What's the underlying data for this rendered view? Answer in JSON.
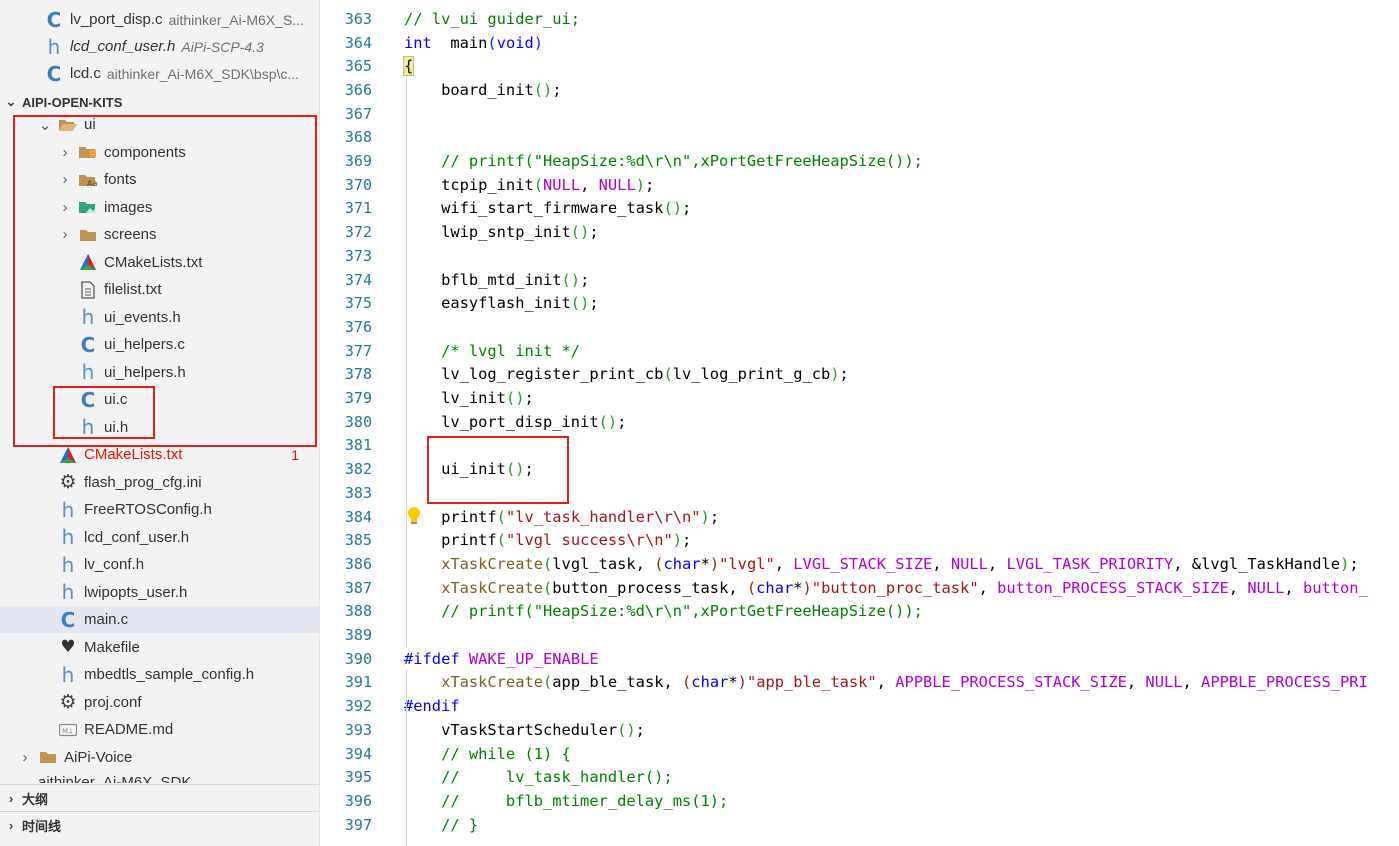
{
  "sidebar": {
    "open_editors": [
      {
        "icon": "c",
        "label": "lv_port_disp.c",
        "desc": "aithinker_Ai-M6X_S..."
      },
      {
        "icon": "h",
        "label": "lcd_conf_user.h",
        "desc": "AiPi-SCP-4.3",
        "italic": true
      },
      {
        "icon": "c",
        "label": "lcd.c",
        "desc": "aithinker_Ai-M6X_SDK\\bsp\\c..."
      }
    ],
    "workspace_title": "AIPI-OPEN-KITS",
    "tree": [
      {
        "depth": 1,
        "chev": "down",
        "icon": "folder-open",
        "label": "ui"
      },
      {
        "depth": 2,
        "chev": "right",
        "icon": "folder-components",
        "label": "components"
      },
      {
        "depth": 2,
        "chev": "right",
        "icon": "folder-fonts",
        "label": "fonts"
      },
      {
        "depth": 2,
        "chev": "right",
        "icon": "folder-images",
        "label": "images"
      },
      {
        "depth": 2,
        "chev": "right",
        "icon": "folder",
        "label": "screens"
      },
      {
        "depth": 2,
        "chev": "",
        "icon": "cmake",
        "label": "CMakeLists.txt"
      },
      {
        "depth": 2,
        "chev": "",
        "icon": "file",
        "label": "filelist.txt"
      },
      {
        "depth": 2,
        "chev": "",
        "icon": "h",
        "label": "ui_events.h"
      },
      {
        "depth": 2,
        "chev": "",
        "icon": "c",
        "label": "ui_helpers.c"
      },
      {
        "depth": 2,
        "chev": "",
        "icon": "h",
        "label": "ui_helpers.h"
      },
      {
        "depth": 2,
        "chev": "",
        "icon": "c",
        "label": "ui.c"
      },
      {
        "depth": 2,
        "chev": "",
        "icon": "h",
        "label": "ui.h"
      },
      {
        "depth": 1,
        "chev": "",
        "icon": "cmake",
        "label": "CMakeLists.txt",
        "error": true,
        "badge": "1"
      },
      {
        "depth": 1,
        "chev": "",
        "icon": "gear",
        "label": "flash_prog_cfg.ini"
      },
      {
        "depth": 1,
        "chev": "",
        "icon": "h",
        "label": "FreeRTOSConfig.h"
      },
      {
        "depth": 1,
        "chev": "",
        "icon": "h",
        "label": "lcd_conf_user.h"
      },
      {
        "depth": 1,
        "chev": "",
        "icon": "h",
        "label": "lv_conf.h"
      },
      {
        "depth": 1,
        "chev": "",
        "icon": "h",
        "label": "lwipopts_user.h"
      },
      {
        "depth": 1,
        "chev": "",
        "icon": "c",
        "label": "main.c",
        "selected": true
      },
      {
        "depth": 1,
        "chev": "",
        "icon": "makefile",
        "label": "Makefile"
      },
      {
        "depth": 1,
        "chev": "",
        "icon": "h",
        "label": "mbedtls_sample_config.h"
      },
      {
        "depth": 1,
        "chev": "",
        "icon": "gear",
        "label": "proj.conf"
      },
      {
        "depth": 1,
        "chev": "",
        "icon": "md",
        "label": "README.md"
      },
      {
        "depth": 0,
        "chev": "right",
        "icon": "folder",
        "label": "AiPi-Voice"
      }
    ],
    "partial_item": "aithinker_Ai-M6X_SDK",
    "outline_title": "大纲",
    "timeline_title": "时间线"
  },
  "editor": {
    "lines": [
      {
        "n": "363",
        "t": [
          [
            "cmt",
            "// lv_ui guider_ui;"
          ]
        ]
      },
      {
        "n": "364",
        "t": [
          [
            "kw",
            "int"
          ],
          [
            "",
            "  main"
          ],
          [
            "par1",
            "("
          ],
          [
            "kw",
            "void"
          ],
          [
            "par1",
            ")"
          ]
        ]
      },
      {
        "n": "365",
        "t": [
          [
            "brace",
            "{"
          ]
        ]
      },
      {
        "n": "366",
        "t": [
          [
            "",
            "    board_init"
          ],
          [
            "par2",
            "()"
          ],
          [
            "",
            ";"
          ]
        ]
      },
      {
        "n": "367",
        "t": []
      },
      {
        "n": "368",
        "t": []
      },
      {
        "n": "369",
        "t": [
          [
            "cmt",
            "    // printf(\"HeapSize:%d\\r\\n\",xPortGetFreeHeapSize());"
          ]
        ]
      },
      {
        "n": "370",
        "t": [
          [
            "",
            "    tcpip_init"
          ],
          [
            "par2",
            "("
          ],
          [
            "mac",
            "NULL"
          ],
          [
            "",
            ", "
          ],
          [
            "mac",
            "NULL"
          ],
          [
            "par2",
            ")"
          ],
          [
            "",
            ";"
          ]
        ]
      },
      {
        "n": "371",
        "t": [
          [
            "",
            "    wifi_start_firmware_task"
          ],
          [
            "par2",
            "()"
          ],
          [
            "",
            ";"
          ]
        ]
      },
      {
        "n": "372",
        "t": [
          [
            "",
            "    lwip_sntp_init"
          ],
          [
            "par2",
            "()"
          ],
          [
            "",
            ";"
          ]
        ]
      },
      {
        "n": "373",
        "t": []
      },
      {
        "n": "374",
        "t": [
          [
            "",
            "    bflb_mtd_init"
          ],
          [
            "par2",
            "()"
          ],
          [
            "",
            ";"
          ]
        ]
      },
      {
        "n": "375",
        "t": [
          [
            "",
            "    easyflash_init"
          ],
          [
            "par2",
            "()"
          ],
          [
            "",
            ";"
          ]
        ]
      },
      {
        "n": "376",
        "t": []
      },
      {
        "n": "377",
        "t": [
          [
            "cmt",
            "    /* lvgl init */"
          ]
        ]
      },
      {
        "n": "378",
        "t": [
          [
            "",
            "    lv_log_register_print_cb"
          ],
          [
            "par2",
            "("
          ],
          [
            "",
            "lv_log_print_g_cb"
          ],
          [
            "par2",
            ")"
          ],
          [
            "",
            ";"
          ]
        ]
      },
      {
        "n": "379",
        "t": [
          [
            "",
            "    lv_init"
          ],
          [
            "par2",
            "()"
          ],
          [
            "",
            ";"
          ]
        ]
      },
      {
        "n": "380",
        "t": [
          [
            "",
            "    lv_port_disp_init"
          ],
          [
            "par2",
            "()"
          ],
          [
            "",
            ";"
          ]
        ]
      },
      {
        "n": "381",
        "t": []
      },
      {
        "n": "382",
        "t": [
          [
            "",
            "    ui_init"
          ],
          [
            "par2",
            "()"
          ],
          [
            "",
            ";"
          ]
        ]
      },
      {
        "n": "383",
        "t": []
      },
      {
        "n": "384",
        "t": [
          [
            "",
            "    printf"
          ],
          [
            "par2",
            "("
          ],
          [
            "str",
            "\"lv_task_handler\\r\\n\""
          ],
          [
            "par2",
            ")"
          ],
          [
            "",
            ";"
          ]
        ]
      },
      {
        "n": "385",
        "t": [
          [
            "",
            "    printf"
          ],
          [
            "par2",
            "("
          ],
          [
            "str",
            "\"lvgl success\\r\\n\""
          ],
          [
            "par2",
            ")"
          ],
          [
            "",
            ";"
          ]
        ]
      },
      {
        "n": "386",
        "t": [
          [
            "fn",
            "    xTaskCreate"
          ],
          [
            "par2",
            "("
          ],
          [
            "",
            "lvgl_task, "
          ],
          [
            "par3",
            "("
          ],
          [
            "kw",
            "char"
          ],
          [
            "",
            "*"
          ],
          [
            "par3",
            ")"
          ],
          [
            "str",
            "\"lvgl\""
          ],
          [
            "",
            ", "
          ],
          [
            "mac",
            "LVGL_STACK_SIZE"
          ],
          [
            "",
            ", "
          ],
          [
            "mac",
            "NULL"
          ],
          [
            "",
            ", "
          ],
          [
            "mac",
            "LVGL_TASK_PRIORITY"
          ],
          [
            "",
            ", &lvgl_TaskHandle"
          ],
          [
            "par2",
            ")"
          ],
          [
            "",
            ";"
          ]
        ]
      },
      {
        "n": "387",
        "t": [
          [
            "fn",
            "    xTaskCreate"
          ],
          [
            "par2",
            "("
          ],
          [
            "",
            "button_process_task, "
          ],
          [
            "par3",
            "("
          ],
          [
            "kw",
            "char"
          ],
          [
            "",
            "*"
          ],
          [
            "par3",
            ")"
          ],
          [
            "str",
            "\"button_proc_task\""
          ],
          [
            "",
            ", "
          ],
          [
            "mac",
            "button_PROCESS_STACK_SIZE"
          ],
          [
            "",
            ", "
          ],
          [
            "mac",
            "NULL"
          ],
          [
            "",
            ", "
          ],
          [
            "mac",
            "button_"
          ]
        ]
      },
      {
        "n": "388",
        "t": [
          [
            "cmt",
            "    // printf(\"HeapSize:%d\\r\\n\",xPortGetFreeHeapSize());"
          ]
        ]
      },
      {
        "n": "389",
        "t": []
      },
      {
        "n": "390",
        "t": [
          [
            "pre",
            "#ifdef"
          ],
          [
            "",
            " "
          ],
          [
            "mac",
            "WAKE_UP_ENABLE"
          ]
        ]
      },
      {
        "n": "391",
        "t": [
          [
            "fn",
            "    xTaskCreate"
          ],
          [
            "par2",
            "("
          ],
          [
            "",
            "app_ble_task, "
          ],
          [
            "par3",
            "("
          ],
          [
            "kw",
            "char"
          ],
          [
            "",
            "*"
          ],
          [
            "par3",
            ")"
          ],
          [
            "str",
            "\"app_ble_task\""
          ],
          [
            "",
            ", "
          ],
          [
            "mac",
            "APPBLE_PROCESS_STACK_SIZE"
          ],
          [
            "",
            ", "
          ],
          [
            "mac",
            "NULL"
          ],
          [
            "",
            ", "
          ],
          [
            "mac",
            "APPBLE_PROCESS_PRI"
          ]
        ]
      },
      {
        "n": "392",
        "t": [
          [
            "pre",
            "#endif"
          ]
        ]
      },
      {
        "n": "393",
        "t": [
          [
            "",
            "    vTaskStartScheduler"
          ],
          [
            "par2",
            "()"
          ],
          [
            "",
            ";"
          ]
        ]
      },
      {
        "n": "394",
        "t": [
          [
            "cmt",
            "    // while (1) {"
          ]
        ]
      },
      {
        "n": "395",
        "t": [
          [
            "cmt",
            "    //     lv_task_handler();"
          ]
        ]
      },
      {
        "n": "396",
        "t": [
          [
            "cmt",
            "    //     bflb_mtimer_delay_ms(1);"
          ]
        ]
      },
      {
        "n": "397",
        "t": [
          [
            "cmt",
            "    // }"
          ]
        ]
      }
    ]
  }
}
